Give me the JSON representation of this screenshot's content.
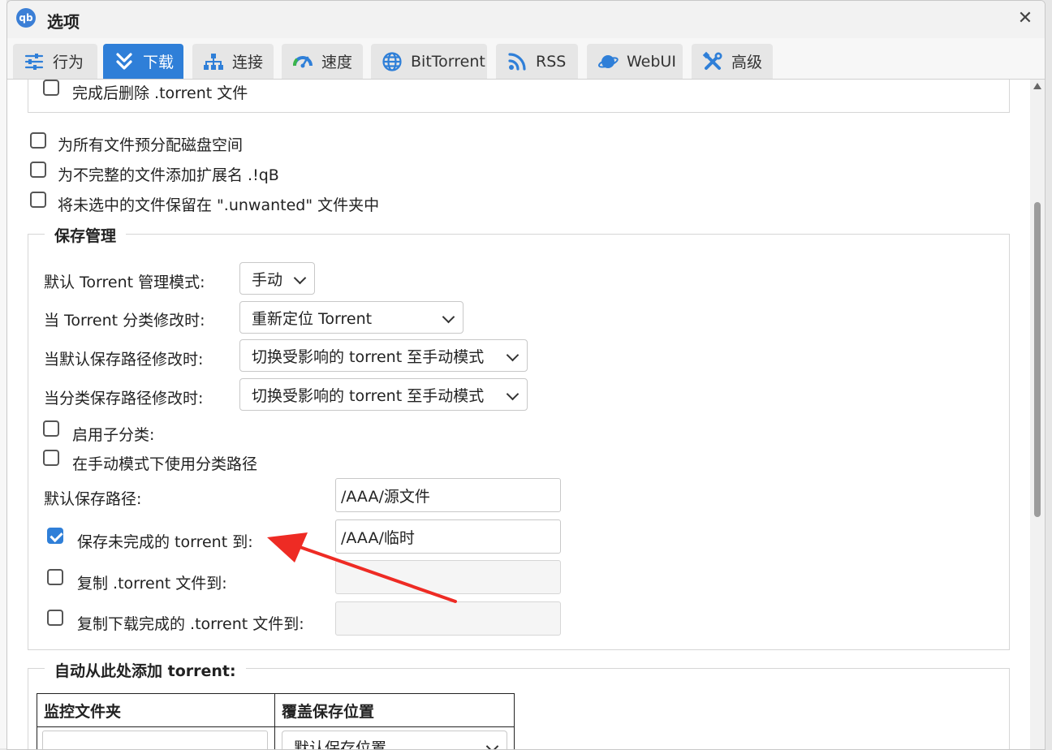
{
  "window": {
    "app_icon_text": "qb",
    "title": "选项",
    "close_symbol": "✕"
  },
  "tabs": [
    {
      "label": "行为",
      "icon": "sliders-icon",
      "active": false
    },
    {
      "label": "下载",
      "icon": "download-chevrons-icon",
      "active": true
    },
    {
      "label": "连接",
      "icon": "network-icon",
      "active": false
    },
    {
      "label": "速度",
      "icon": "speedometer-icon",
      "active": false
    },
    {
      "label": "BitTorrent",
      "icon": "globe-icon",
      "active": false
    },
    {
      "label": "RSS",
      "icon": "rss-icon",
      "active": false
    },
    {
      "label": "WebUI",
      "icon": "planet-icon",
      "active": false
    },
    {
      "label": "高级",
      "icon": "tools-icon",
      "active": false
    }
  ],
  "options": {
    "delete_torrent_after": {
      "label": "完成后删除 .torrent 文件",
      "checked": false
    },
    "preallocate": {
      "label": "为所有文件预分配磁盘空间",
      "checked": false
    },
    "append_extension": {
      "label": "为不完整的文件添加扩展名 .!qB",
      "checked": false
    },
    "keep_unwanted": {
      "label": "将未选中的文件保留在 \".unwanted\" 文件夹中",
      "checked": false
    }
  },
  "save_management": {
    "legend": "保存管理",
    "default_mode_label": "默认 Torrent 管理模式:",
    "default_mode_value": "手动",
    "category_changed_label": "当 Torrent 分类修改时:",
    "category_changed_value": "重新定位 Torrent",
    "default_path_changed_label": "当默认保存路径修改时:",
    "default_path_changed_value": "切换受影响的 torrent 至手动模式",
    "category_path_changed_label": "当分类保存路径修改时:",
    "category_path_changed_value": "切换受影响的 torrent 至手动模式",
    "subcategories_label": "启用子分类:",
    "subcategories_checked": false,
    "category_paths_manual_label": "在手动模式下使用分类路径",
    "category_paths_manual_checked": false,
    "default_save_path_label": "默认保存路径:",
    "default_save_path_value": "/AAA/源文件",
    "temp_path_label": "保存未完成的 torrent 到:",
    "temp_path_checked": true,
    "temp_path_value": "/AAA/临时",
    "copy_torrent_label": "复制 .torrent 文件到:",
    "copy_torrent_checked": false,
    "copy_torrent_value": "",
    "copy_finished_label": "复制下载完成的 .torrent 文件到:",
    "copy_finished_checked": false,
    "copy_finished_value": ""
  },
  "auto_add": {
    "legend": "自动从此处添加 torrent:",
    "col_folder": "监控文件夹",
    "col_override": "覆盖保存位置",
    "row_select_value": "默认保存位置"
  },
  "annotation": {
    "color": "#ee2b24"
  },
  "colors": {
    "accent": "#2f7fd8"
  }
}
